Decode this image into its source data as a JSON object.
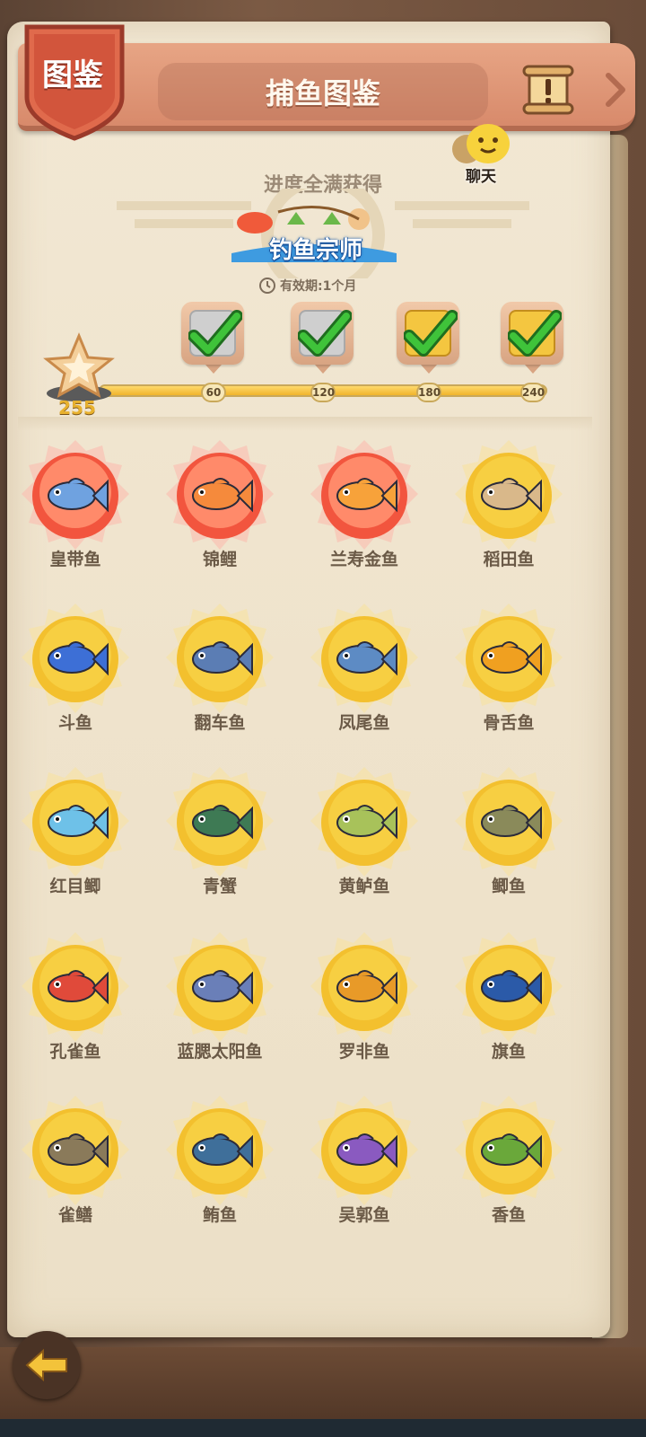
{
  "header": {
    "badge_label": "图鉴",
    "title": "捕鱼图鉴",
    "chat_label": "聊天"
  },
  "reward": {
    "caption": "进度全满获得",
    "title": "钓鱼宗师",
    "validity": "有效期:1个月"
  },
  "progress": {
    "score": "255",
    "fraction": 1.0,
    "milestones": [
      {
        "value": "60",
        "claimed": true,
        "tier": "silver"
      },
      {
        "value": "120",
        "claimed": true,
        "tier": "silver"
      },
      {
        "value": "180",
        "claimed": true,
        "tier": "gold"
      },
      {
        "value": "240",
        "claimed": true,
        "tier": "gold"
      }
    ]
  },
  "fish": [
    {
      "name": "皇带鱼",
      "rarity": "red",
      "color": "#6fa2e0"
    },
    {
      "name": "锦鲤",
      "rarity": "red",
      "color": "#f58a3c"
    },
    {
      "name": "兰寿金鱼",
      "rarity": "red",
      "color": "#f7a23a"
    },
    {
      "name": "稻田鱼",
      "rarity": "gold",
      "color": "#d9b88a"
    },
    {
      "name": "斗鱼",
      "rarity": "gold",
      "color": "#3d6fd6"
    },
    {
      "name": "翻车鱼",
      "rarity": "gold",
      "color": "#5b7db4"
    },
    {
      "name": "凤尾鱼",
      "rarity": "gold",
      "color": "#5d8bc4"
    },
    {
      "name": "骨舌鱼",
      "rarity": "gold",
      "color": "#f0a020"
    },
    {
      "name": "红目鲫",
      "rarity": "gold",
      "color": "#6ec1e8"
    },
    {
      "name": "青蟹",
      "rarity": "gold",
      "color": "#3e7a54"
    },
    {
      "name": "黄鲈鱼",
      "rarity": "gold",
      "color": "#a8c25a"
    },
    {
      "name": "鲫鱼",
      "rarity": "gold",
      "color": "#8a8a5a"
    },
    {
      "name": "孔雀鱼",
      "rarity": "gold",
      "color": "#e04a3a"
    },
    {
      "name": "蓝腮太阳鱼",
      "rarity": "gold",
      "color": "#6a7fb8"
    },
    {
      "name": "罗非鱼",
      "rarity": "gold",
      "color": "#e89a28"
    },
    {
      "name": "旗鱼",
      "rarity": "gold",
      "color": "#2b5aa8"
    },
    {
      "name": "雀鳝",
      "rarity": "gold",
      "color": "#8a7a5a"
    },
    {
      "name": "鲔鱼",
      "rarity": "gold",
      "color": "#3f6f9a"
    },
    {
      "name": "吴郭鱼",
      "rarity": "gold",
      "color": "#8a5ac0"
    },
    {
      "name": "香鱼",
      "rarity": "gold",
      "color": "#6aa83a"
    }
  ],
  "colors": {
    "header": "#d88a6b",
    "badge": "#c8503a",
    "gold_ring": "#f3c02e",
    "red_ring": "#f2553e",
    "text_brown": "#6b5a47"
  }
}
